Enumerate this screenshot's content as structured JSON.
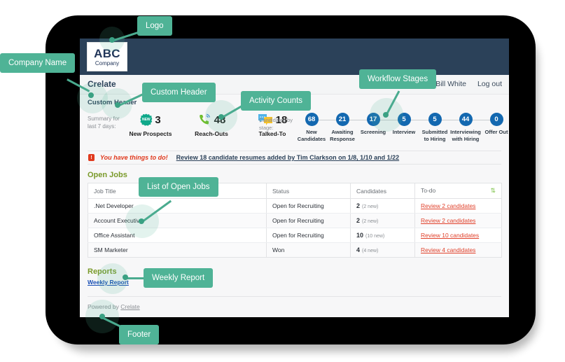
{
  "app": {
    "logo": {
      "name": "ABC",
      "suffix": "Company"
    },
    "title": "Crelate",
    "custom_header": "Custom Header",
    "user": "Bill White",
    "logout": "Log out",
    "header_color": "#2b4159",
    "accent_color": "#4fb396"
  },
  "summary": {
    "label": "Summary for last 7 days:",
    "items": [
      {
        "icon": "new-prospects-icon",
        "value": "3",
        "caption": "New Prospects"
      },
      {
        "icon": "reach-outs-icon",
        "value": "48",
        "caption": "Reach-Outs"
      },
      {
        "icon": "talked-to-icon",
        "value": "18",
        "caption": "Talked-To"
      }
    ]
  },
  "stages": {
    "label": "Candidates by stage:",
    "items": [
      {
        "count": "68",
        "name": "New Candidates"
      },
      {
        "count": "21",
        "name": "Awaiting Response"
      },
      {
        "count": "17",
        "name": "Screening"
      },
      {
        "count": "5",
        "name": "Interview"
      },
      {
        "count": "5",
        "name": "Submitted to Hiring"
      },
      {
        "count": "44",
        "name": "Interviewing with Hiring"
      },
      {
        "count": "0",
        "name": "Offer Out"
      }
    ]
  },
  "alert": {
    "icon": "alert-icon",
    "title": "You have things to do!",
    "link": "Review 18 candidate resumes added by Tim Clarkson on 1/8, 1/10 and 1/22"
  },
  "open_jobs": {
    "title": "Open Jobs",
    "refresh_icon": "refresh-icon",
    "columns": [
      "Job Title",
      "Status",
      "Candidates",
      "To-do"
    ],
    "rows": [
      {
        "title": ".Net Developer",
        "status": "Open for Recruiting",
        "count": "2",
        "new": "(2 new)",
        "todo": "Review 2 candidates"
      },
      {
        "title": "Account Executive",
        "status": "Open for Recruiting",
        "count": "2",
        "new": "(2 new)",
        "todo": "Review 2 candidates"
      },
      {
        "title": "Office Assistant",
        "status": "Open for Recruiting",
        "count": "10",
        "new": "(10 new)",
        "todo": "Review 10 candidates"
      },
      {
        "title": "SM Marketer",
        "status": "Won",
        "count": "4",
        "new": "(4 new)",
        "todo": "Review 4 candidates"
      }
    ]
  },
  "reports": {
    "title": "Reports",
    "link": "Weekly Report"
  },
  "footer": {
    "prefix": "Powered by",
    "brand": "Crelate"
  },
  "callouts": [
    {
      "id": "company-name",
      "label": "Company Name"
    },
    {
      "id": "logo",
      "label": "Logo"
    },
    {
      "id": "custom-header",
      "label": "Custom Header"
    },
    {
      "id": "activity",
      "label": "Activity Counts"
    },
    {
      "id": "workflow",
      "label": "Workflow Stages"
    },
    {
      "id": "open-jobs",
      "label": "List of Open Jobs"
    },
    {
      "id": "weekly",
      "label": "Weekly Report"
    },
    {
      "id": "footer",
      "label": "Footer"
    }
  ]
}
